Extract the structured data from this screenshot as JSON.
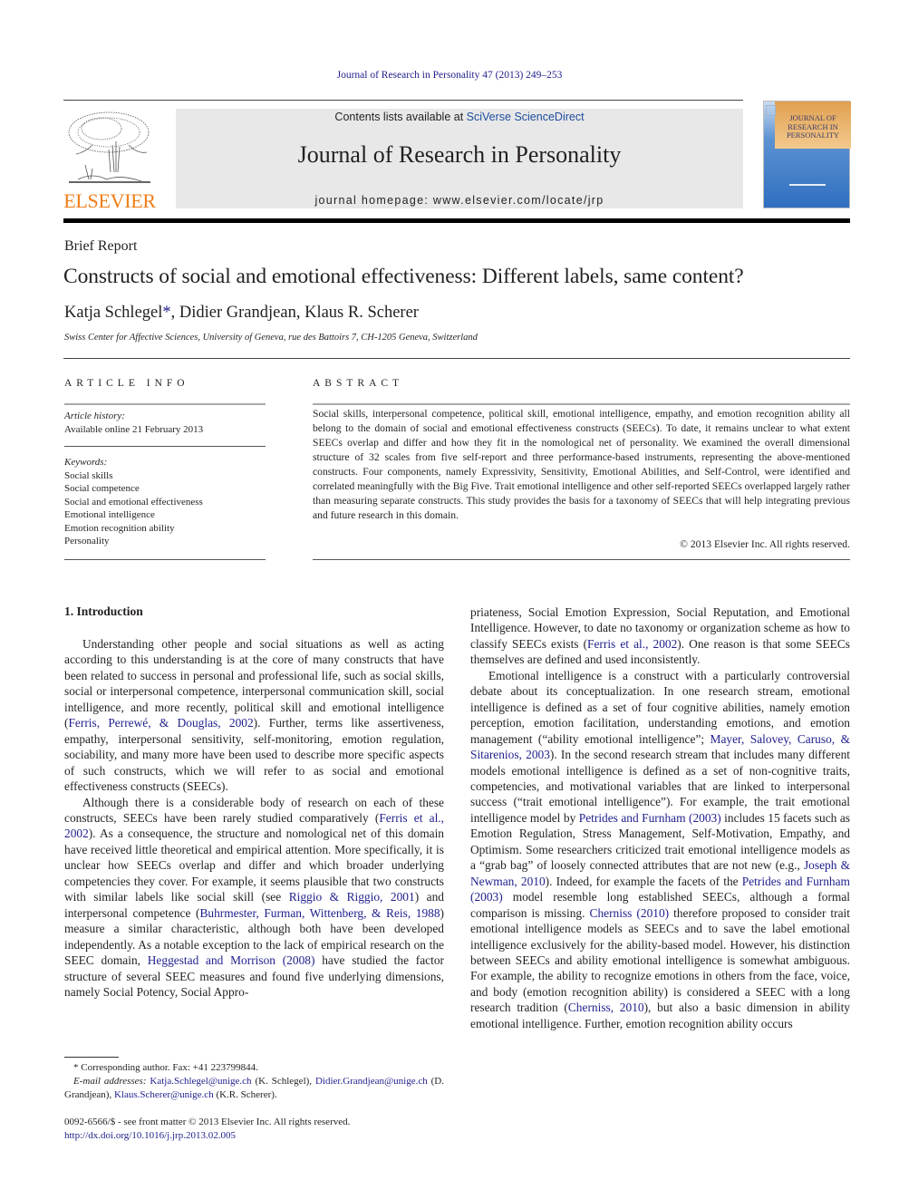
{
  "running_head": "Journal of Research in Personality 47 (2013) 249–253",
  "masthead": {
    "contents_prefix": "Contents lists available at ",
    "contents_link": "SciVerse ScienceDirect",
    "journal_title": "Journal of Research in Personality",
    "homepage": "journal homepage: www.elsevier.com/locate/jrp",
    "publisher": "ELSEVIER",
    "cover_title": "JOURNAL OF RESEARCH IN PERSONALITY"
  },
  "colors": {
    "link": "#1f1f8c",
    "publisher_orange": "#f07d18",
    "masthead_bg": "#e8e8e8"
  },
  "article": {
    "type": "Brief Report",
    "title": "Constructs of social and emotional effectiveness: Different labels, same content?",
    "authors": [
      {
        "name": "Katja Schlegel",
        "mark": "*"
      },
      {
        "name": "Didier Grandjean"
      },
      {
        "name": "Klaus R. Scherer"
      }
    ],
    "author_sep": ", ",
    "affiliation": "Swiss Center for Affective Sciences, University of Geneva, rue des Battoirs 7, CH-1205 Geneva, Switzerland"
  },
  "article_info": {
    "heading": "ARTICLE INFO",
    "history_label": "Article history:",
    "history_value": "Available online 21 February 2013",
    "keywords_label": "Keywords:",
    "keywords": [
      "Social skills",
      "Social competence",
      "Social and emotional effectiveness",
      "Emotional intelligence",
      "Emotion recognition ability",
      "Personality"
    ]
  },
  "abstract": {
    "heading": "ABSTRACT",
    "text": "Social skills, interpersonal competence, political skill, emotional intelligence, empathy, and emotion recognition ability all belong to the domain of social and emotional effectiveness constructs (SEECs). To date, it remains unclear to what extent SEECs overlap and differ and how they fit in the nomological net of personality. We examined the overall dimensional structure of 32 scales from five self-report and three performance-based instruments, representing the above-mentioned constructs. Four components, namely Expressivity, Sensitivity, Emotional Abilities, and Self-Control, were identified and correlated meaningfully with the Big Five. Trait emotional intelligence and other self-reported SEECs overlapped largely rather than measuring separate constructs. This study provides the basis for a taxonomy of SEECs that will help integrating previous and future research in this domain.",
    "copyright": "© 2013 Elsevier Inc. All rights reserved."
  },
  "body": {
    "section_heading": "1. Introduction",
    "left": {
      "p1": [
        {
          "t": "Understanding other people and social situations as well as acting according to this understanding is at the core of many constructs that have been related to success in personal and professional life, such as social skills, social or interpersonal competence, interpersonal communication skill, social intelligence, and more recently, political skill and emotional intelligence ("
        },
        {
          "t": "Ferris, Perrewé, & Douglas, 2002",
          "link": true
        },
        {
          "t": "). Further, terms like assertiveness, empathy, interpersonal sensitivity, self-monitoring, emotion regulation, sociability, and many more have been used to describe more specific aspects of such constructs, which we will refer to as social and emotional effectiveness constructs (SEECs)."
        }
      ],
      "p2": [
        {
          "t": "Although there is a considerable body of research on each of these constructs, SEECs have been rarely studied comparatively ("
        },
        {
          "t": "Ferris et al., 2002",
          "link": true
        },
        {
          "t": "). As a consequence, the structure and nomological net of this domain have received little theoretical and empirical attention. More specifically, it is unclear how SEECs overlap and differ and which broader underlying competencies they cover. For example, it seems plausible that two constructs with similar labels like social skill (see "
        },
        {
          "t": "Riggio & Riggio, 2001",
          "link": true
        },
        {
          "t": ") and interpersonal competence ("
        },
        {
          "t": "Buhrmester, Furman, Wittenberg, & Reis, 1988",
          "link": true
        },
        {
          "t": ") measure a similar characteristic, although both have been developed independently. As a notable exception to the lack of empirical research on the SEEC domain, "
        },
        {
          "t": "Heggestad and Morrison (2008)",
          "link": true
        },
        {
          "t": " have studied the factor structure of several SEEC measures and found five underlying dimensions, namely Social Potency, Social Appro-"
        }
      ]
    },
    "right": {
      "p1": [
        {
          "t": "priateness, Social Emotion Expression, Social Reputation, and Emotional Intelligence. However, to date no taxonomy or organization scheme as how to classify SEECs exists ("
        },
        {
          "t": "Ferris et al., 2002",
          "link": true
        },
        {
          "t": "). One reason is that some SEECs themselves are defined and used inconsistently."
        }
      ],
      "p2": [
        {
          "t": "Emotional intelligence is a construct with a particularly controversial debate about its conceptualization. In one research stream, emotional intelligence is defined as a set of four cognitive abilities, namely emotion perception, emotion facilitation, understanding emotions, and emotion management (“ability emotional intelligence”; "
        },
        {
          "t": "Mayer, Salovey, Caruso, & Sitarenios, 2003",
          "link": true
        },
        {
          "t": "). In the second research stream that includes many different models emotional intelligence is defined as a set of non-cognitive traits, competencies, and motivational variables that are linked to interpersonal success (“trait emotional intelligence”). For example, the trait emotional intelligence model by "
        },
        {
          "t": "Petrides and Furnham (2003)",
          "link": true
        },
        {
          "t": " includes 15 facets such as Emotion Regulation, Stress Management, Self-Motivation, Empathy, and Optimism. Some researchers criticized trait emotional intelligence models as a “grab bag” of loosely connected attributes that are not new (e.g., "
        },
        {
          "t": "Joseph & Newman, 2010",
          "link": true
        },
        {
          "t": "). Indeed, for example the facets of the "
        },
        {
          "t": "Petrides and Furnham (2003)",
          "link": true
        },
        {
          "t": " model resemble long established SEECs, although a formal comparison is missing. "
        },
        {
          "t": "Cherniss (2010)",
          "link": true
        },
        {
          "t": " therefore proposed to consider trait emotional intelligence models as SEECs and to save the label emotional intelligence exclusively for the ability-based model. However, his distinction between SEECs and ability emotional intelligence is somewhat ambiguous. For example, the ability to recognize emotions in others from the face, voice, and body (emotion recognition ability) is considered a SEEC with a long research tradition ("
        },
        {
          "t": "Cherniss, 2010",
          "link": true
        },
        {
          "t": "), but also a basic dimension in ability emotional intelligence. Further, emotion recognition ability occurs"
        }
      ]
    }
  },
  "footnotes": {
    "corresponding": "* Corresponding author. Fax: +41 223799844.",
    "email_label": "E-mail addresses:",
    "emails": [
      {
        "addr": "Katja.Schlegel@unige.ch",
        "who": " (K. Schlegel), "
      },
      {
        "addr": "Didier.Grandjean@unige.ch",
        "who": " (D. Grandjean), "
      },
      {
        "addr": "Klaus.Scherer@unige.ch",
        "who": " (K.R. Scherer)."
      }
    ]
  },
  "issn_line": "0092-6566/$ - see front matter © 2013 Elsevier Inc. All rights reserved.",
  "doi": "http://dx.doi.org/10.1016/j.jrp.2013.02.005"
}
